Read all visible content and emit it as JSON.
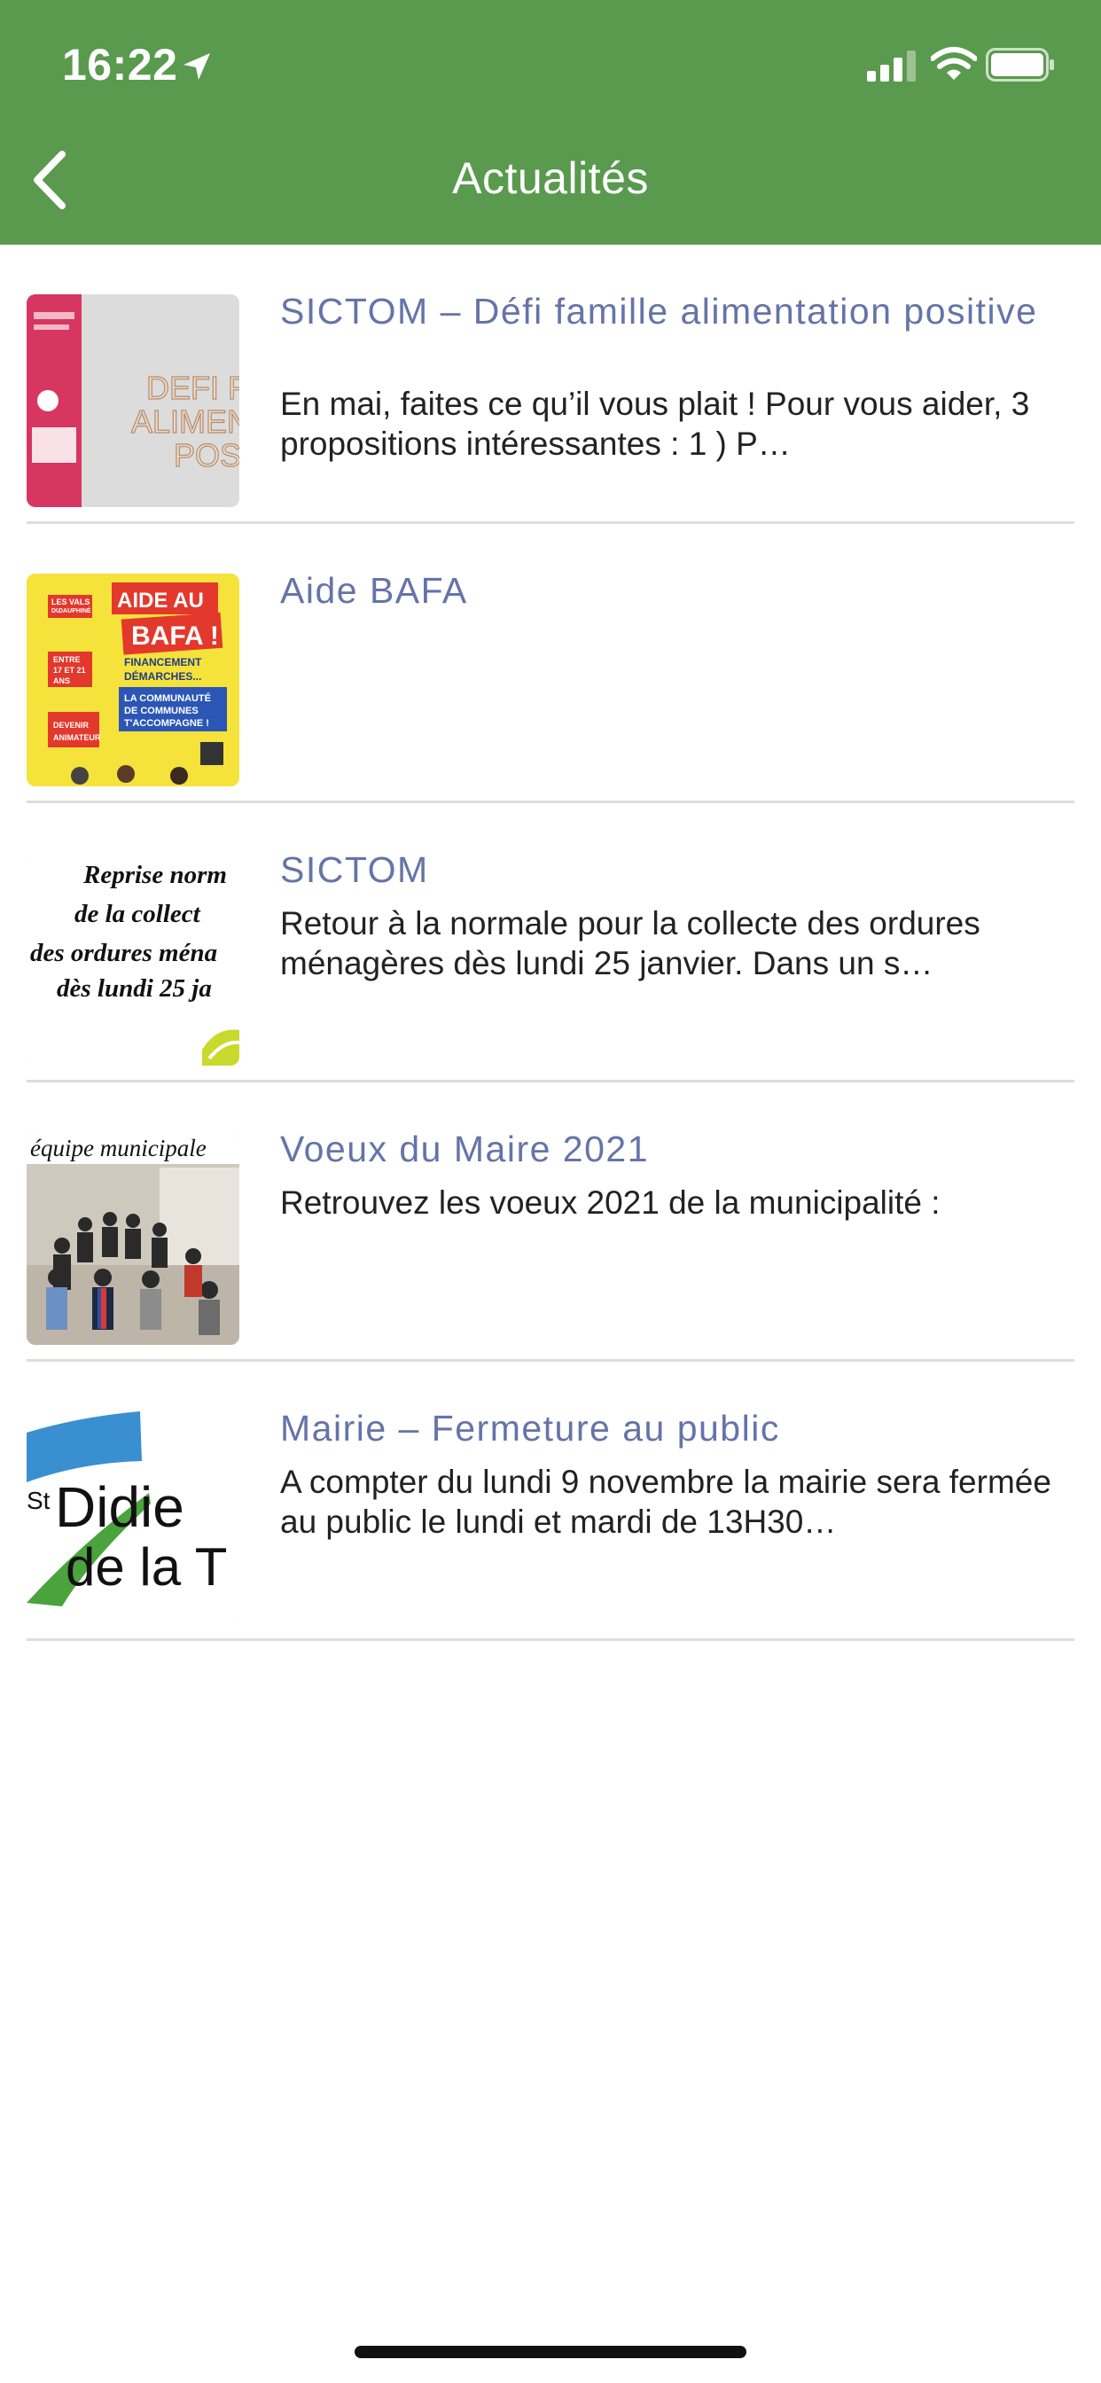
{
  "status_bar": {
    "time": "16:22"
  },
  "header": {
    "title": "Actualités",
    "color": "#5a9a4e"
  },
  "news": [
    {
      "title": "SICTOM – Défi famille alimentation positive",
      "excerpt": "En mai, faites ce qu’il vous plait ! Pour vous aider, 3 propositions intéressantes : 1 ) P…",
      "thumb_text": [
        "DEFI F",
        "ALIMEN",
        "POS"
      ]
    },
    {
      "title": "Aide BAFA",
      "excerpt": "",
      "thumb_text": [
        "AIDE AU",
        "BAFA !",
        "FINANCEMENT",
        "DÉMARCHES...",
        "LA COMMUNAUTÉ",
        "DE COMMUNES",
        "T'ACCOMPAGNE !",
        "ENTRE",
        "17 ET 21",
        "ANS",
        "DEVENIR",
        "ANIMATEUR",
        "LES VALS",
        "DU",
        "DAUPHINÉ"
      ]
    },
    {
      "title": "SICTOM",
      "excerpt": "Retour à la normale pour la collecte des ordures ménagères dès lundi 25 janvier. Dans un s…",
      "thumb_text": [
        "Reprise norm",
        "de la collect",
        "des ordures ména",
        "dès lundi 25 ja"
      ]
    },
    {
      "title": "Voeux du Maire 2021",
      "excerpt": "Retrouvez les voeux 2021 de la municipalité :",
      "thumb_text": [
        "équipe municipale"
      ]
    },
    {
      "title": "Mairie – Fermeture au public",
      "excerpt": "A compter du lundi 9 novembre la mairie sera fermée au public le lundi et mardi  de 13H30…",
      "thumb_text": [
        "St",
        "Didie",
        "de la T"
      ]
    }
  ]
}
